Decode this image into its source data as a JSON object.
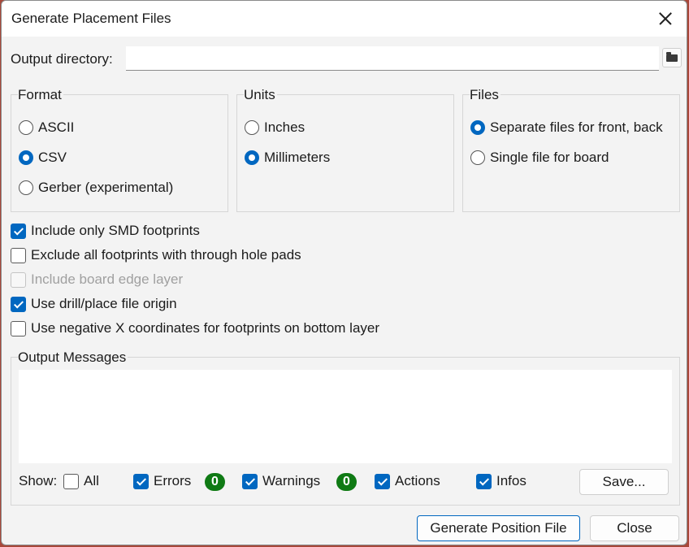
{
  "dialog": {
    "title": "Generate Placement Files"
  },
  "output_directory": {
    "label": "Output directory:",
    "value": "",
    "browse_icon": "folder-icon"
  },
  "format": {
    "title": "Format",
    "options": [
      {
        "label": "ASCII",
        "selected": false
      },
      {
        "label": "CSV",
        "selected": true
      },
      {
        "label": "Gerber (experimental)",
        "selected": false
      }
    ]
  },
  "units": {
    "title": "Units",
    "options": [
      {
        "label": "Inches",
        "selected": false
      },
      {
        "label": "Millimeters",
        "selected": true
      }
    ]
  },
  "files": {
    "title": "Files",
    "options": [
      {
        "label": "Separate files for front, back",
        "selected": true
      },
      {
        "label": "Single file for board",
        "selected": false
      }
    ]
  },
  "options": [
    {
      "label": "Include only SMD footprints",
      "checked": true,
      "enabled": true
    },
    {
      "label": "Exclude all footprints with through hole pads",
      "checked": false,
      "enabled": true
    },
    {
      "label": "Include board edge layer",
      "checked": false,
      "enabled": false
    },
    {
      "label": "Use drill/place file origin",
      "checked": true,
      "enabled": true
    },
    {
      "label": "Use negative X coordinates for footprints on bottom layer",
      "checked": false,
      "enabled": true
    }
  ],
  "messages": {
    "title": "Output Messages",
    "show_label": "Show:",
    "filters": {
      "all": {
        "label": "All",
        "checked": false
      },
      "errors": {
        "label": "Errors",
        "checked": true,
        "count": "0"
      },
      "warnings": {
        "label": "Warnings",
        "checked": true,
        "count": "0"
      },
      "actions": {
        "label": "Actions",
        "checked": true
      },
      "infos": {
        "label": "Infos",
        "checked": true
      }
    },
    "save_label": "Save..."
  },
  "buttons": {
    "generate": "Generate Position File",
    "close": "Close"
  },
  "colors": {
    "accent": "#0067c0",
    "badge": "#0f7a14"
  }
}
